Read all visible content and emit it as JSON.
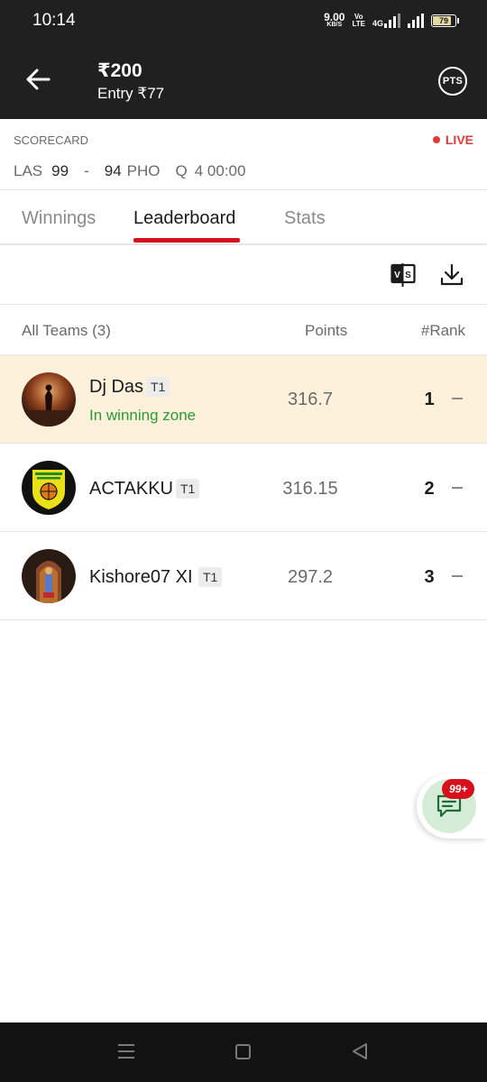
{
  "status_bar": {
    "time": "10:14",
    "speed_value": "9.00",
    "speed_unit": "KB/S",
    "volte_top": "Vo",
    "volte_bottom": "LTE",
    "network": "4G",
    "battery": "79"
  },
  "header": {
    "prize": "₹200",
    "entry": "Entry ₹77",
    "pts_label": "PTS"
  },
  "scorecard": {
    "label": "SCORECARD",
    "live_label": "LIVE",
    "team_a": "LAS",
    "score_a": "99",
    "separator": "-",
    "score_b": "94",
    "team_b": "PHO",
    "quarter": "Q",
    "clock": "4 00:00"
  },
  "tabs": [
    {
      "label": "Winnings"
    },
    {
      "label": "Leaderboard"
    },
    {
      "label": "Stats"
    }
  ],
  "active_tab": "Leaderboard",
  "table": {
    "col_teams": "All Teams (3)",
    "col_points": "Points",
    "col_rank": "#Rank",
    "rows": [
      {
        "name": "Dj Das",
        "tag": "T1",
        "subtext": "In winning zone",
        "points": "316.7",
        "rank": "1"
      },
      {
        "name": "ACTAKKU",
        "tag": "T1",
        "subtext": "",
        "points": "316.15",
        "rank": "2"
      },
      {
        "name": "Kishore07 XI",
        "tag": "T1",
        "subtext": "",
        "points": "297.2",
        "rank": "3"
      }
    ]
  },
  "chat": {
    "badge": "99+"
  },
  "colors": {
    "accent_red": "#d6101c",
    "winning_bg": "#fdf1dc",
    "winning_text": "#2a9b33",
    "header_bg": "#202020"
  }
}
